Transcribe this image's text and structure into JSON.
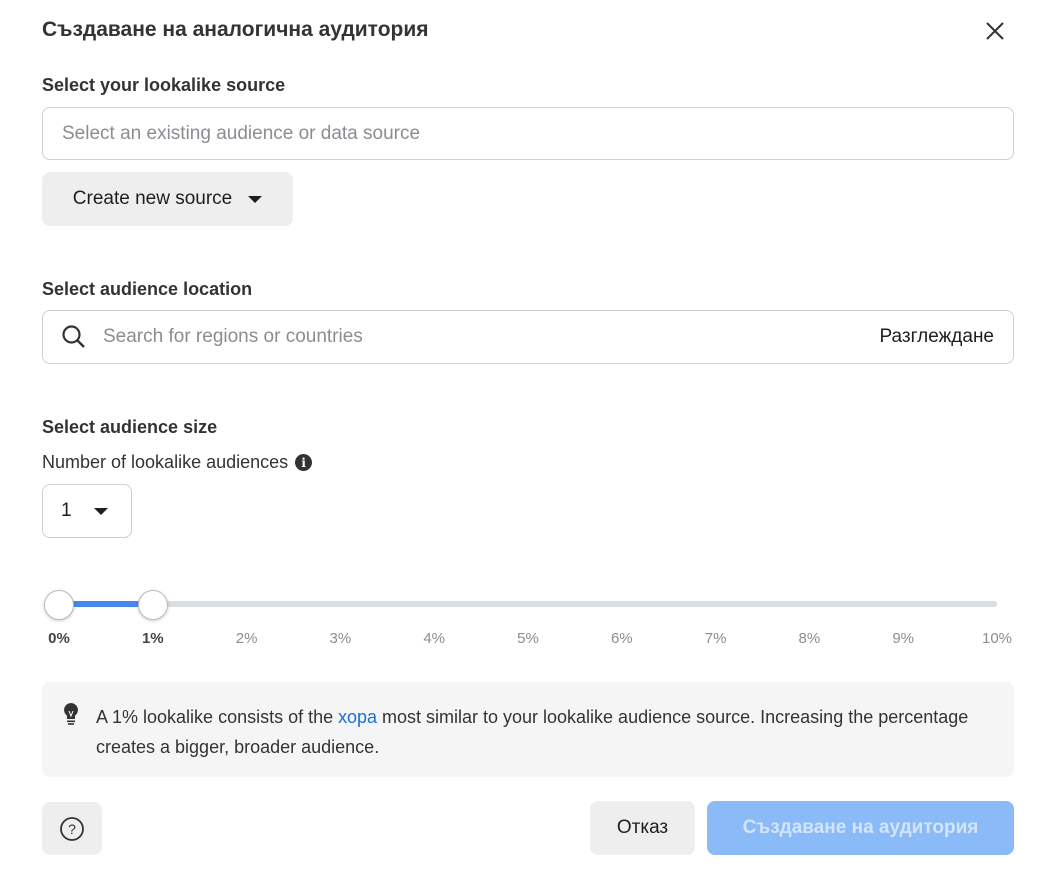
{
  "dialog": {
    "title": "Създаване на аналогична аудитория"
  },
  "source": {
    "label": "Select your lookalike source",
    "placeholder": "Select an existing audience or data source",
    "create_button": "Create new source"
  },
  "location": {
    "label": "Select audience location",
    "placeholder": "Search for regions or countries",
    "browse": "Разглеждане"
  },
  "size": {
    "label": "Select audience size",
    "count_label": "Number of lookalike audiences",
    "count_value": "1",
    "slider": {
      "range_start_percent": 0,
      "range_end_percent": 1,
      "min": 0,
      "max": 10,
      "accent": "#4a86f0",
      "ticks": [
        "0%",
        "1%",
        "2%",
        "3%",
        "4%",
        "5%",
        "6%",
        "7%",
        "8%",
        "9%",
        "10%"
      ]
    }
  },
  "info": {
    "text_before": "A 1% lookalike consists of the ",
    "link": "хора",
    "text_after": " most similar to your lookalike audience source. Increasing the percentage creates a bigger, broader audience."
  },
  "footer": {
    "cancel": "Отказ",
    "create": "Създаване на аудитория",
    "create_color": "#8bbaf8"
  }
}
